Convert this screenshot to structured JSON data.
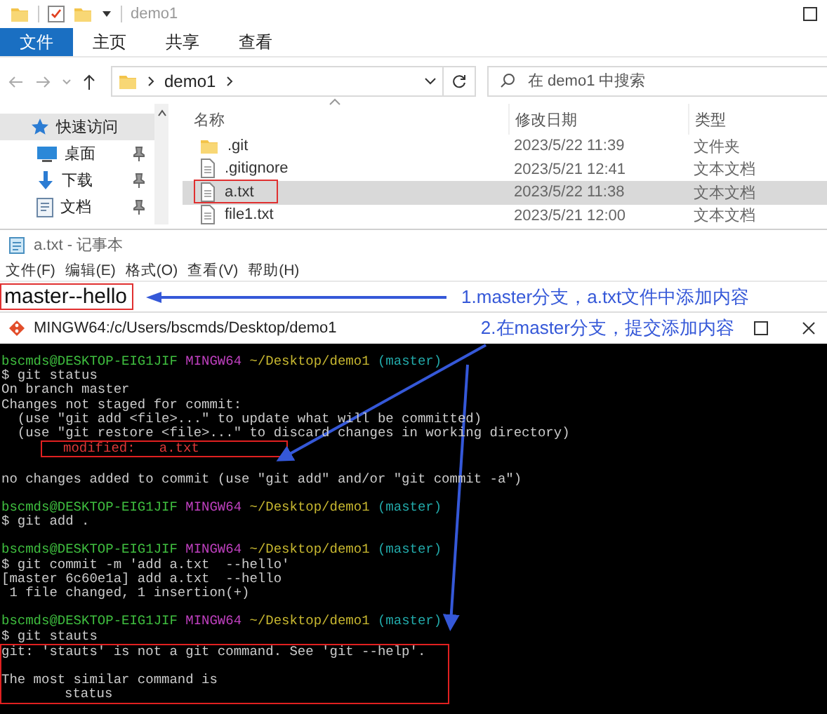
{
  "explorer": {
    "title": "demo1",
    "tabs": [
      {
        "label": "文件",
        "selected": true
      },
      {
        "label": "主页",
        "selected": false
      },
      {
        "label": "共享",
        "selected": false
      },
      {
        "label": "查看",
        "selected": false
      }
    ],
    "breadcrumb": [
      "demo1"
    ],
    "search": {
      "placeholder": "在 demo1 中搜索"
    },
    "nav_items": [
      {
        "label": "快速访问",
        "kind": "star",
        "selected": true,
        "pinned": false
      },
      {
        "label": "桌面",
        "kind": "desktop",
        "selected": false,
        "pinned": true
      },
      {
        "label": "下载",
        "kind": "download",
        "selected": false,
        "pinned": true
      },
      {
        "label": "文档",
        "kind": "document",
        "selected": false,
        "pinned": true
      }
    ],
    "columns": [
      "名称",
      "修改日期",
      "类型"
    ],
    "files": [
      {
        "name": ".git",
        "kind": "folder",
        "modified": "2023/5/22 11:39",
        "type": "文件夹",
        "selected": false,
        "highlighted": false
      },
      {
        "name": ".gitignore",
        "kind": "file",
        "modified": "2023/5/21 12:41",
        "type": "文本文档",
        "selected": false,
        "highlighted": false
      },
      {
        "name": "a.txt",
        "kind": "file",
        "modified": "2023/5/22 11:38",
        "type": "文本文档",
        "selected": true,
        "highlighted": true
      },
      {
        "name": "file1.txt",
        "kind": "file",
        "modified": "2023/5/21 12:00",
        "type": "文本文档",
        "selected": false,
        "highlighted": false
      }
    ]
  },
  "notepad": {
    "title": "a.txt - 记事本",
    "menu": [
      "文件(F)",
      "编辑(E)",
      "格式(O)",
      "查看(V)",
      "帮助(H)"
    ],
    "text": "master--hello",
    "highlighted": true,
    "note": "1.master分支，a.txt文件中添加内容"
  },
  "terminal": {
    "title": "MINGW64:/c/Users/bscmds/Desktop/demo1",
    "note": "2.在master分支，提交添加内容",
    "lines": [
      {
        "kind": "prompt",
        "user": "bscmds@DESKTOP-EIG1JIF",
        "system": "MINGW64",
        "path": "~/Desktop/demo1",
        "branch": "(master)"
      },
      {
        "kind": "text",
        "text": "$ git status"
      },
      {
        "kind": "text",
        "text": "On branch master"
      },
      {
        "kind": "text",
        "text": "Changes not staged for commit:"
      },
      {
        "kind": "text",
        "text": "  (use \"git add <file>...\" to update what will be committed)"
      },
      {
        "kind": "text",
        "text": "  (use \"git restore <file>...\" to discard changes in working directory)"
      },
      {
        "kind": "modified",
        "text": "modified:   a.txt",
        "boxed": true
      },
      {
        "kind": "blank"
      },
      {
        "kind": "text",
        "text": "no changes added to commit (use \"git add\" and/or \"git commit -a\")"
      },
      {
        "kind": "blank"
      },
      {
        "kind": "prompt",
        "user": "bscmds@DESKTOP-EIG1JIF",
        "system": "MINGW64",
        "path": "~/Desktop/demo1",
        "branch": "(master)"
      },
      {
        "kind": "text",
        "text": "$ git add ."
      },
      {
        "kind": "blank"
      },
      {
        "kind": "prompt",
        "user": "bscmds@DESKTOP-EIG1JIF",
        "system": "MINGW64",
        "path": "~/Desktop/demo1",
        "branch": "(master)"
      },
      {
        "kind": "text",
        "text": "$ git commit -m 'add a.txt  --hello'"
      },
      {
        "kind": "text",
        "text": "[master 6c60e1a] add a.txt  --hello"
      },
      {
        "kind": "text",
        "text": " 1 file changed, 1 insertion(+)"
      },
      {
        "kind": "blank"
      },
      {
        "kind": "prompt",
        "user": "bscmds@DESKTOP-EIG1JIF",
        "system": "MINGW64",
        "path": "~/Desktop/demo1",
        "branch": "(master)"
      },
      {
        "kind": "text",
        "text": "$ git stauts"
      },
      {
        "kind": "text",
        "text": "git: 'stauts' is not a git command. See 'git --help'.",
        "boxed": true
      },
      {
        "kind": "blank",
        "boxed": true
      },
      {
        "kind": "text",
        "text": "The most similar command is",
        "boxed": true
      },
      {
        "kind": "indented",
        "text": "status",
        "boxed": true
      }
    ]
  }
}
